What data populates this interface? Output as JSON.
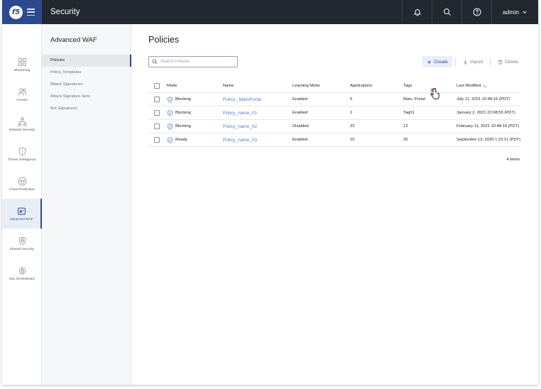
{
  "app": {
    "title": "Security",
    "logo_text": "f5"
  },
  "header": {
    "user": "admin",
    "icons": [
      "bell-icon",
      "search-icon",
      "help-icon"
    ]
  },
  "rail": {
    "items": [
      {
        "label": "Monitoring",
        "icon": "grid-icon"
      },
      {
        "label": "Access",
        "icon": "users-icon"
      },
      {
        "label": "Network Security",
        "icon": "network-icon"
      },
      {
        "label": "Threat Intelligence",
        "icon": "shield-icon"
      },
      {
        "label": "Fraud Protection",
        "icon": "mask-icon"
      },
      {
        "label": "Advanced WAF",
        "icon": "waf-icon",
        "active": true
      },
      {
        "label": "Shared Security",
        "icon": "shield-lock-icon"
      },
      {
        "label": "SSL Orchestrator",
        "icon": "lock-badge-icon"
      }
    ]
  },
  "subnav": {
    "title": "Advanced WAF",
    "items": [
      {
        "label": "Policies",
        "active": true
      },
      {
        "label": "Policy Templates"
      },
      {
        "label": "Attack Signatures"
      },
      {
        "label": "Attack Signature Sets"
      },
      {
        "label": "Bot Signatures"
      }
    ]
  },
  "main": {
    "title": "Policies",
    "search_placeholder": "Search Policies",
    "actions": {
      "create": "Create",
      "import": "Import",
      "delete": "Delete"
    },
    "columns": {
      "mode": "Mode",
      "name": "Name",
      "learning": "Learning Mode",
      "apps": "Applications",
      "tags": "Tags",
      "modified": "Last Modified"
    },
    "rows": [
      {
        "mode": "Blocking",
        "name": "Policy _MainPortal",
        "learning": "Enabled",
        "apps": "5",
        "tags": "Main, Portal",
        "modified": "July 11, 2021 10:48:16 (PDT)"
      },
      {
        "mode": "Blocking",
        "name": "Policy_name_01",
        "learning": "Enabled",
        "apps": "1",
        "tags": "Tag01",
        "modified": "January 2, 2021 22:08:55 (PDT)"
      },
      {
        "mode": "Blocking",
        "name": "Policy_name_02",
        "learning": "Disabled",
        "apps": "22",
        "tags": "12",
        "modified": "February 11, 2021 10:48:16 (PDT)"
      },
      {
        "mode": "Ready",
        "name": "Policy_name_03",
        "learning": "Enabled",
        "apps": "10",
        "tags": "26",
        "modified": "September 13, 2020 1:22:11 (PDT)"
      }
    ],
    "count": "4 items"
  },
  "colors": {
    "topbar": "#222730",
    "brand": "#2b4a8f",
    "link": "#4d7dd1"
  }
}
